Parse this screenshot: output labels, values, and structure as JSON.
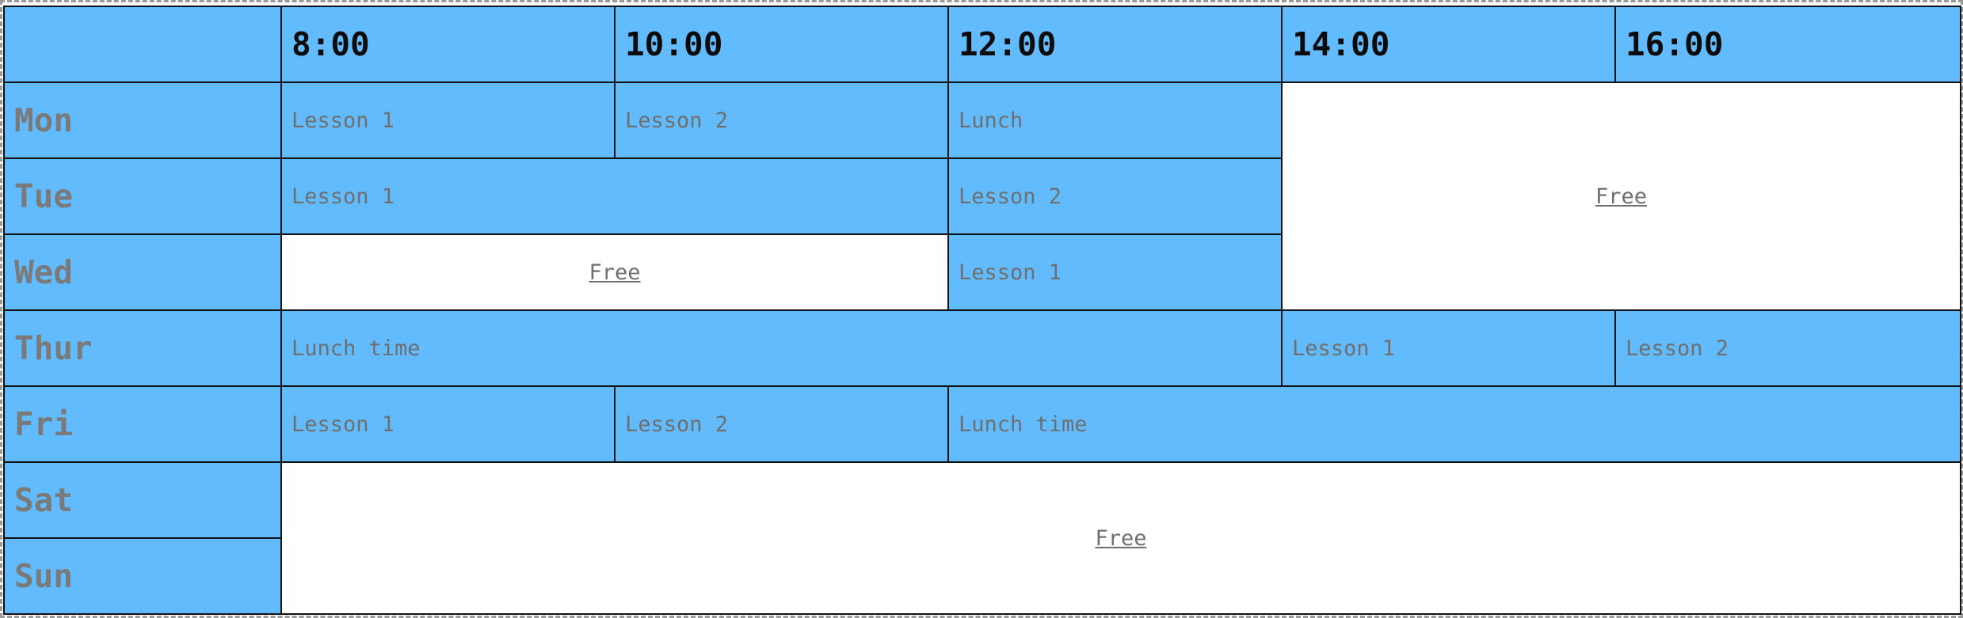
{
  "times": [
    "8:00",
    "10:00",
    "12:00",
    "14:00",
    "16:00"
  ],
  "days": [
    "Mon",
    "Tue",
    "Wed",
    "Thur",
    "Fri",
    "Sat",
    "Sun"
  ],
  "cells": {
    "mon": [
      "Lesson 1",
      "Lesson 2",
      "Lunch",
      "Free"
    ],
    "tue": [
      "Lesson 1",
      "Lesson 2"
    ],
    "wed": [
      "Free",
      "Lesson 1"
    ],
    "thur": [
      "Lunch time",
      "Lesson 1",
      "Lesson 2"
    ],
    "fri": [
      "Lesson 1",
      "Lesson 2",
      "Lunch time"
    ],
    "sat": [
      "Free"
    ]
  },
  "colors": {
    "cell": "#61bbfc",
    "free": "#ffffff",
    "border": "#111111"
  }
}
